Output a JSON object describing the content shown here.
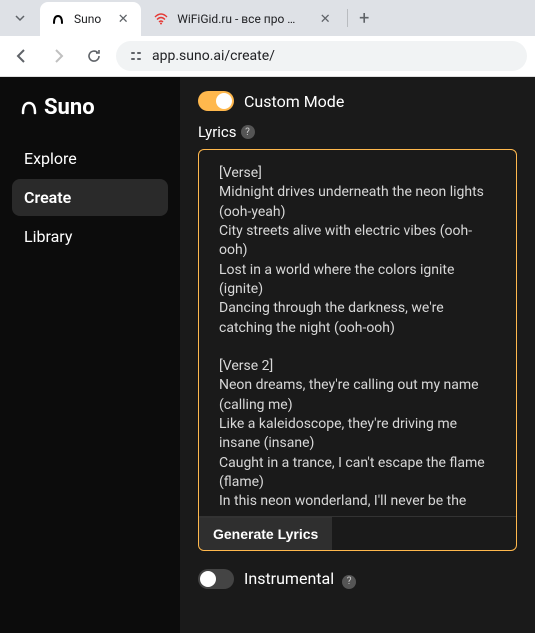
{
  "browser": {
    "tabs": [
      {
        "title": "Suno",
        "active": true
      },
      {
        "title": "WiFiGid.ru - все про WiFi и бе",
        "active": false
      }
    ],
    "url": "app.suno.ai/create/"
  },
  "sidebar": {
    "logo_text": "Suno",
    "items": [
      {
        "label": "Explore",
        "active": false
      },
      {
        "label": "Create",
        "active": true
      },
      {
        "label": "Library",
        "active": false
      }
    ]
  },
  "main": {
    "custom_mode": {
      "label": "Custom Mode",
      "on": true
    },
    "lyrics": {
      "label": "Lyrics",
      "value": "[Verse]\nMidnight drives underneath the neon lights (ooh-yeah)\nCity streets alive with electric vibes (ooh-ooh)\nLost in a world where the colors ignite (ignite)\nDancing through the darkness, we're catching the night (ooh-ooh)\n\n[Verse 2]\nNeon dreams, they're calling out my name (calling me)\nLike a kaleidoscope, they're driving me insane (insane)\nCaught in a trance, I can't escape the flame (flame)\nIn this neon wonderland, I'll never be the same"
    },
    "generate_button": "Generate Lyrics",
    "instrumental": {
      "label": "Instrumental",
      "on": false
    }
  }
}
